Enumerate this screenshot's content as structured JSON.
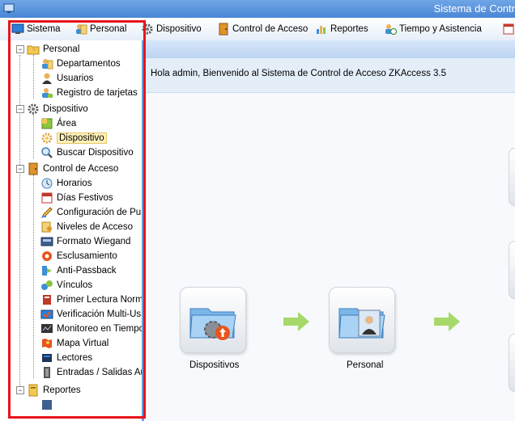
{
  "window": {
    "title": "Sistema de Contr"
  },
  "menu": {
    "items": [
      {
        "label": "Sistema",
        "icon": "monitor-icon"
      },
      {
        "label": "Personal",
        "icon": "people-icon"
      },
      {
        "label": "Dispositivo",
        "icon": "gear-icon"
      },
      {
        "label": "Control de Acceso",
        "icon": "door-icon"
      },
      {
        "label": "Reportes",
        "icon": "report-icon"
      },
      {
        "label": "Tiempo y Asistencia",
        "icon": "clock-icon"
      }
    ]
  },
  "sidebar": {
    "groups": [
      {
        "label": "Personal",
        "items": [
          "Departamentos",
          "Usuarios",
          "Registro de tarjetas"
        ]
      },
      {
        "label": "Dispositivo",
        "items": [
          "Área",
          "Dispositivo",
          "Buscar Dispositivo"
        ]
      },
      {
        "label": "Control de Acceso",
        "items": [
          "Horarios",
          "Días Festivos",
          "Configuración de Pu",
          "Niveles de Acceso",
          "Formato Wiegand",
          "Esclusamiento",
          "Anti-Passback",
          "Vínculos",
          "Primer Lectura Norm",
          "Verificación Multi-Us",
          "Monitoreo en Tiempo",
          "Mapa Virtual",
          "Lectores",
          "Entradas / Salidas Au"
        ]
      },
      {
        "label": "Reportes",
        "items": []
      }
    ],
    "selected": "Dispositivo"
  },
  "welcome": {
    "text": "Hola admin, Bienvenido al Sistema de Control de Acceso ZKAccess 3.5"
  },
  "flow": {
    "steps": [
      {
        "label": "Dispositivos"
      },
      {
        "label": "Personal"
      }
    ]
  },
  "colors": {
    "accent": "#4a86d6",
    "highlight": "#e8141c",
    "arrow": "#8cc63f"
  }
}
